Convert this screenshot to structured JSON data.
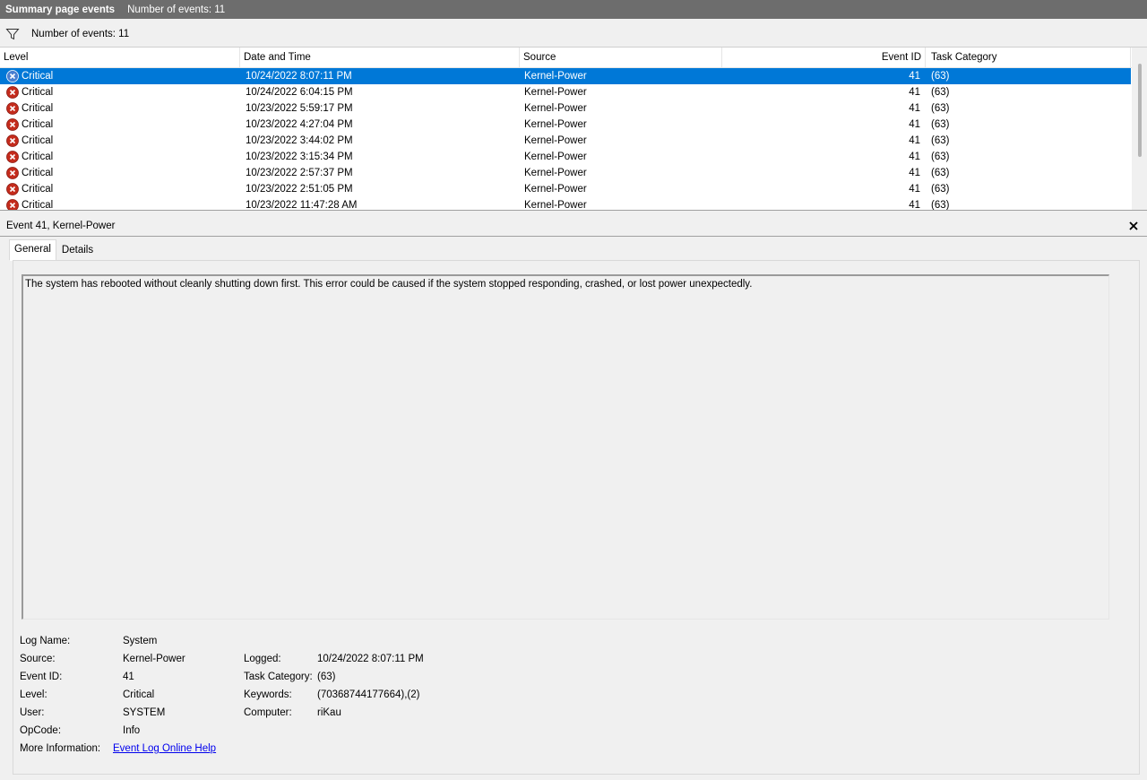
{
  "title_bar": {
    "title": "Summary page events",
    "count_label": "Number of events: 11"
  },
  "filter_bar": {
    "icon": "filter-funnel-icon",
    "label": "Number of events: 11"
  },
  "grid": {
    "columns": [
      "Level",
      "Date and Time",
      "Source",
      "Event ID",
      "Task Category"
    ],
    "rows": [
      {
        "level": "Critical",
        "datetime": "10/24/2022 8:07:11 PM",
        "source": "Kernel-Power",
        "event_id": "41",
        "task_category": "(63)",
        "selected": true
      },
      {
        "level": "Critical",
        "datetime": "10/24/2022 6:04:15 PM",
        "source": "Kernel-Power",
        "event_id": "41",
        "task_category": "(63)"
      },
      {
        "level": "Critical",
        "datetime": "10/23/2022 5:59:17 PM",
        "source": "Kernel-Power",
        "event_id": "41",
        "task_category": "(63)"
      },
      {
        "level": "Critical",
        "datetime": "10/23/2022 4:27:04 PM",
        "source": "Kernel-Power",
        "event_id": "41",
        "task_category": "(63)"
      },
      {
        "level": "Critical",
        "datetime": "10/23/2022 3:44:02 PM",
        "source": "Kernel-Power",
        "event_id": "41",
        "task_category": "(63)"
      },
      {
        "level": "Critical",
        "datetime": "10/23/2022 3:15:34 PM",
        "source": "Kernel-Power",
        "event_id": "41",
        "task_category": "(63)"
      },
      {
        "level": "Critical",
        "datetime": "10/23/2022 2:57:37 PM",
        "source": "Kernel-Power",
        "event_id": "41",
        "task_category": "(63)"
      },
      {
        "level": "Critical",
        "datetime": "10/23/2022 2:51:05 PM",
        "source": "Kernel-Power",
        "event_id": "41",
        "task_category": "(63)"
      },
      {
        "level": "Critical",
        "datetime": "10/23/2022 11:47:28 AM",
        "source": "Kernel-Power",
        "event_id": "41",
        "task_category": "(63)"
      }
    ]
  },
  "detail": {
    "header": "Event 41, Kernel-Power",
    "tabs": [
      "General",
      "Details"
    ],
    "message": "The system has rebooted without cleanly shutting down first. This error could be caused if the system stopped responding, crashed, or lost power unexpectedly.",
    "props": {
      "log_name_label": "Log Name:",
      "log_name": "System",
      "source_label": "Source:",
      "source": "Kernel-Power",
      "logged_label": "Logged:",
      "logged": "10/24/2022 8:07:11 PM",
      "event_id_label": "Event ID:",
      "event_id": "41",
      "task_category_label": "Task Category:",
      "task_category": "(63)",
      "level_label": "Level:",
      "level": "Critical",
      "keywords_label": "Keywords:",
      "keywords": "(70368744177664),(2)",
      "user_label": "User:",
      "user": "SYSTEM",
      "computer_label": "Computer:",
      "computer": "riKau",
      "opcode_label": "OpCode:",
      "opcode": "Info",
      "more_info_label": "More Information:",
      "more_info_link": "Event Log Online Help"
    }
  },
  "colors": {
    "selection": "#0078d7",
    "critical_red": "#c42b1c",
    "title_bar": "#6d6d6d",
    "link": "#0000ee"
  }
}
